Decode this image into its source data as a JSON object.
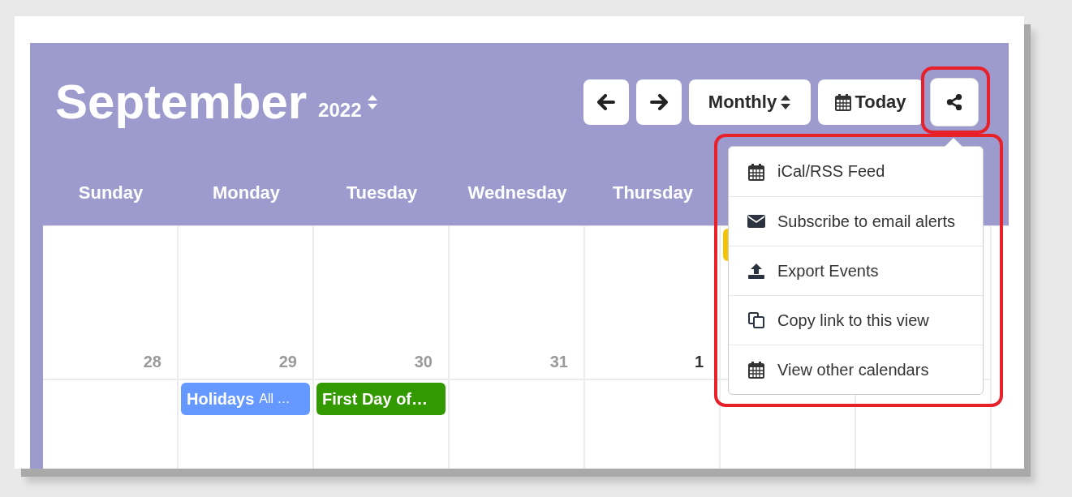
{
  "header": {
    "month": "September",
    "year": "2022"
  },
  "toolbar": [
    {
      "kind": "prev"
    },
    {
      "kind": "next"
    },
    {
      "kind": "view",
      "label": "Monthly"
    },
    {
      "kind": "today",
      "label": "Today"
    },
    {
      "kind": "share",
      "expanded": true
    }
  ],
  "columns": [
    {
      "weekday": "Sunday",
      "days": [
        {
          "number": "28",
          "other_month": true
        }
      ]
    },
    {
      "weekday": "Monday",
      "days": [
        {
          "number": "29",
          "other_month": true
        },
        {
          "events": [
            {
              "title": "Holidays",
              "detail": "All …",
              "color": "#6699ff"
            }
          ]
        }
      ]
    },
    {
      "weekday": "Tuesday",
      "days": [
        {
          "number": "30",
          "other_month": true
        },
        {
          "events": [
            {
              "title": "First Day of…",
              "color": "#339900"
            }
          ]
        }
      ]
    },
    {
      "weekday": "Wednesday",
      "days": [
        {
          "number": "31",
          "other_month": true
        }
      ]
    },
    {
      "weekday": "Thursday",
      "days": [
        {
          "number": "1",
          "other_month": false
        }
      ]
    },
    {
      "days": [
        {
          "events": [
            {
              "color": "#f5c400"
            }
          ]
        }
      ]
    }
  ],
  "share_menu": {
    "items": [
      "iCal/RSS Feed",
      "Subscribe to email alerts",
      "Export Events",
      "Copy link to this view",
      "View other calendars"
    ]
  }
}
